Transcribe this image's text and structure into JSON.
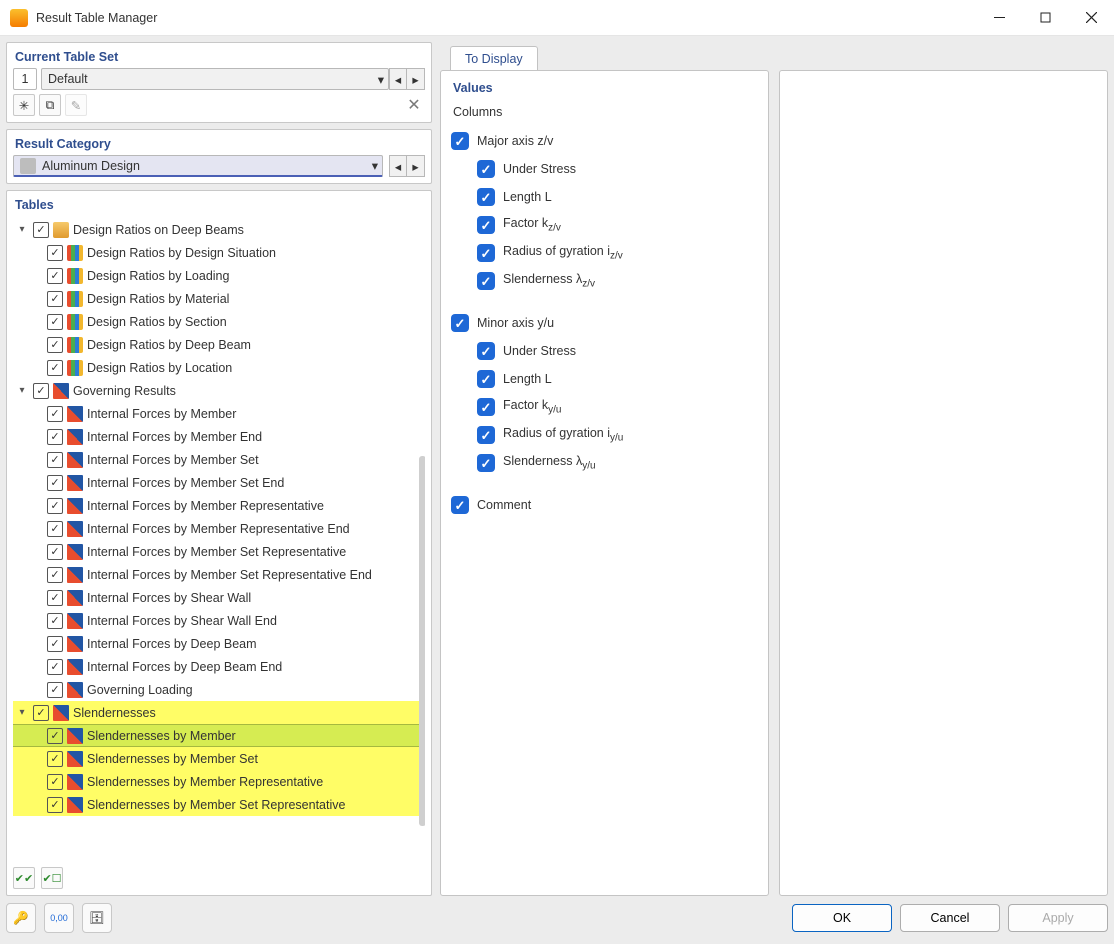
{
  "window": {
    "title": "Result Table Manager"
  },
  "tablesets": {
    "heading": "Current Table Set",
    "number": "1",
    "name": "Default"
  },
  "category": {
    "heading": "Result Category",
    "value": "Aluminum Design"
  },
  "tables": {
    "heading": "Tables",
    "groups": [
      {
        "label": "Design Ratios on Deep Beams",
        "items": [
          "Design Ratios by Design Situation",
          "Design Ratios by Loading",
          "Design Ratios by Material",
          "Design Ratios by Section",
          "Design Ratios by Deep Beam",
          "Design Ratios by Location"
        ]
      },
      {
        "label": "Governing Results",
        "items": [
          "Internal Forces by Member",
          "Internal Forces by Member End",
          "Internal Forces by Member Set",
          "Internal Forces by Member Set End",
          "Internal Forces by Member Representative",
          "Internal Forces by Member Representative End",
          "Internal Forces by Member Set Representative",
          "Internal Forces by Member Set Representative End",
          "Internal Forces by Shear Wall",
          "Internal Forces by Shear Wall End",
          "Internal Forces by Deep Beam",
          "Internal Forces by Deep Beam End",
          "Governing Loading"
        ]
      },
      {
        "label": "Slendernesses",
        "highlight": true,
        "items": [
          "Slendernesses by Member",
          "Slendernesses by Member Set",
          "Slendernesses by Member Representative",
          "Slendernesses by Member Set Representative"
        ],
        "selected": 0
      }
    ]
  },
  "display": {
    "tab": "To Display",
    "values_heading": "Values",
    "columns_heading": "Columns",
    "major": {
      "label": "Major axis z/v",
      "items": [
        {
          "text": "Under Stress"
        },
        {
          "text": "Length L"
        },
        {
          "text": "Factor k",
          "sub": "z/v"
        },
        {
          "text": "Radius of gyration i",
          "sub": "z/v"
        },
        {
          "text": "Slenderness λ",
          "sub": "z/v"
        }
      ]
    },
    "minor": {
      "label": "Minor axis y/u",
      "items": [
        {
          "text": "Under Stress"
        },
        {
          "text": "Length L"
        },
        {
          "text": "Factor k",
          "sub": "y/u"
        },
        {
          "text": "Radius of gyration i",
          "sub": "y/u"
        },
        {
          "text": "Slenderness λ",
          "sub": "y/u"
        }
      ]
    },
    "comment": "Comment"
  },
  "footer": {
    "ok": "OK",
    "cancel": "Cancel",
    "apply": "Apply"
  }
}
